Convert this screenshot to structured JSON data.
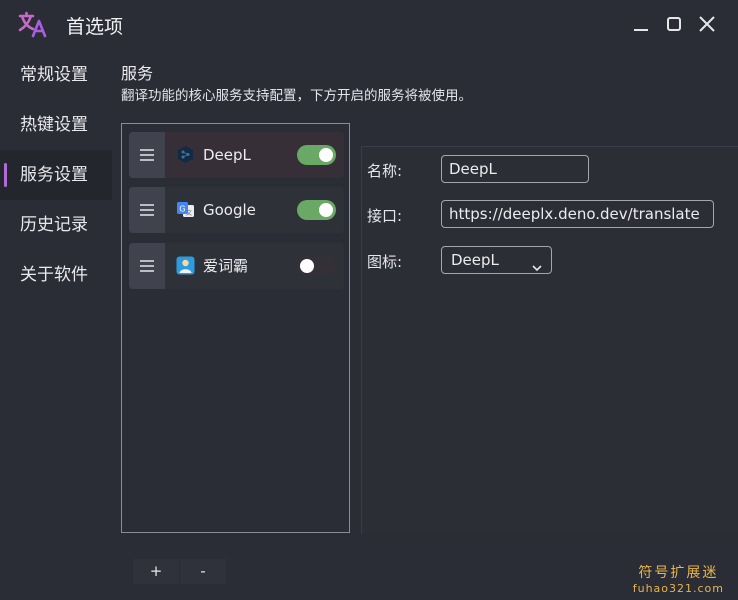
{
  "window": {
    "title": "首选项",
    "logo_icon": "translate-logo-icon",
    "controls": [
      "minimize-icon",
      "maximize-icon",
      "close-icon"
    ]
  },
  "sidebar": {
    "items": [
      {
        "label": "常规设置",
        "active": false
      },
      {
        "label": "热键设置",
        "active": false
      },
      {
        "label": "服务设置",
        "active": true
      },
      {
        "label": "历史记录",
        "active": false
      },
      {
        "label": "关于软件",
        "active": false
      }
    ]
  },
  "section": {
    "title": "服务",
    "description": "翻译功能的核心服务支持配置，下方开启的服务将被使用。"
  },
  "services": [
    {
      "name": "DeepL",
      "icon": "deepl-icon",
      "enabled": true,
      "selected": true
    },
    {
      "name": "Google",
      "icon": "google-translate-icon",
      "enabled": true,
      "selected": false
    },
    {
      "name": "爱词霸",
      "icon": "iciba-icon",
      "enabled": false,
      "selected": false
    }
  ],
  "config": {
    "name_label": "名称:",
    "name_value": "DeepL",
    "api_label": "接口:",
    "api_value": "https://deeplx.deno.dev/translate",
    "icon_label": "图标:",
    "icon_value": "DeepL"
  },
  "footer": {
    "add_label": "+",
    "remove_label": "-"
  },
  "watermark": {
    "cn": "符号扩展迷",
    "en": "fuhao321.com"
  },
  "colors": {
    "accent": "#b06bd6",
    "toggle_on": "#6aa865",
    "background": "#2b2d36"
  }
}
